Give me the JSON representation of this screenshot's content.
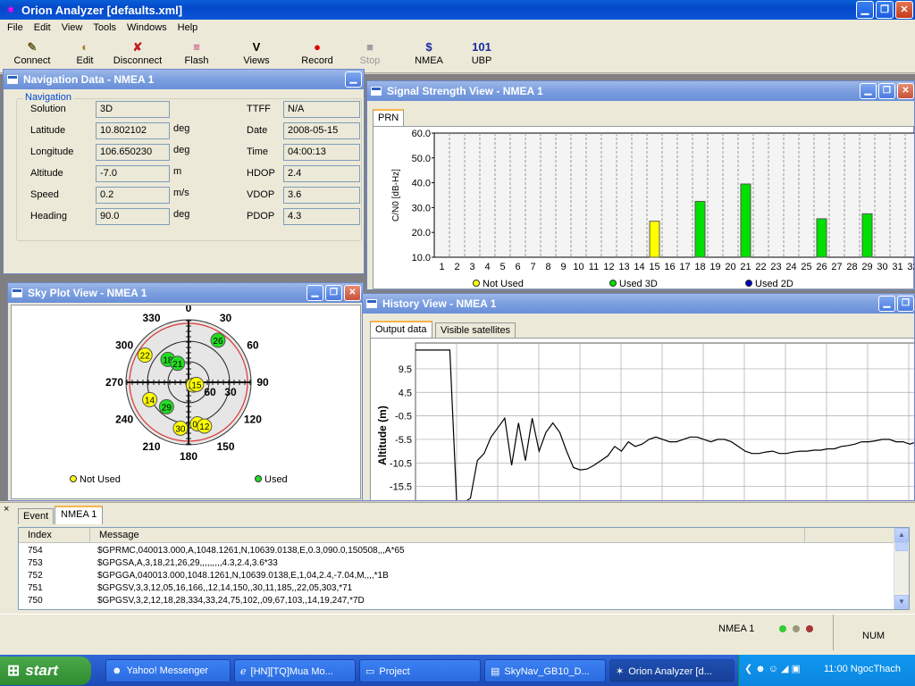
{
  "app": {
    "title": "Orion Analyzer [defaults.xml]"
  },
  "menu": [
    "File",
    "Edit",
    "View",
    "Tools",
    "Windows",
    "Help"
  ],
  "toolbar": [
    {
      "label": "Connect",
      "icon": "connect-icon",
      "glyph": "✎",
      "color": "#6b5b2b",
      "enabled": true
    },
    {
      "label": "Edit",
      "icon": "edit-icon",
      "glyph": "◐",
      "color": "#a08020",
      "enabled": true
    },
    {
      "label": "Disconnect",
      "icon": "disconnect-icon",
      "glyph": "✘",
      "color": "#c02020",
      "enabled": true
    },
    {
      "label": "Flash",
      "icon": "flash-icon",
      "glyph": "≡",
      "color": "#c03070",
      "enabled": true
    },
    {
      "label": "Views",
      "icon": "views-icon",
      "glyph": "V",
      "color": "#000000",
      "enabled": true
    },
    {
      "label": "Record",
      "icon": "record-icon",
      "glyph": "●",
      "color": "#e00000",
      "enabled": true
    },
    {
      "label": "Stop",
      "icon": "stop-icon",
      "glyph": "■",
      "color": "#a0a0a0",
      "enabled": false
    },
    {
      "label": "NMEA",
      "icon": "nmea-icon",
      "glyph": "$",
      "color": "#1a2aa0",
      "enabled": true
    },
    {
      "label": "UBP",
      "icon": "ubp-icon",
      "glyph": "101",
      "color": "#1a2aa0",
      "enabled": true
    }
  ],
  "nav": {
    "title": "Navigation Data - NMEA 1",
    "group": "Navigation",
    "left": [
      {
        "label": "Solution",
        "value": "3D",
        "unit": ""
      },
      {
        "label": "Latitude",
        "value": "10.802102",
        "unit": "deg"
      },
      {
        "label": "Longitude",
        "value": "106.650230",
        "unit": "deg"
      },
      {
        "label": "Altitude",
        "value": "-7.0",
        "unit": "m"
      },
      {
        "label": "Speed",
        "value": "0.2",
        "unit": "m/s"
      },
      {
        "label": "Heading",
        "value": "90.0",
        "unit": "deg"
      }
    ],
    "right": [
      {
        "label": "TTFF",
        "value": "N/A"
      },
      {
        "label": "Date",
        "value": "2008-05-15"
      },
      {
        "label": "Time",
        "value": "04:00:13"
      },
      {
        "label": "HDOP",
        "value": "2.4"
      },
      {
        "label": "VDOP",
        "value": "3.6"
      },
      {
        "label": "PDOP",
        "value": "4.3"
      }
    ]
  },
  "signal": {
    "title": "Signal Strength View - NMEA 1",
    "tab": "PRN",
    "legend": [
      {
        "label": "Not Used",
        "color": "#ffff00"
      },
      {
        "label": "Used 3D",
        "color": "#00e000"
      },
      {
        "label": "Used 2D",
        "color": "#0000c0"
      }
    ]
  },
  "sky": {
    "title": "Sky Plot View - NMEA 1",
    "azimuth_labels": [
      "0",
      "30",
      "60",
      "90",
      "120",
      "150",
      "180",
      "210",
      "240",
      "270",
      "300",
      "330"
    ],
    "elev_labels": [
      "60",
      "30"
    ],
    "legend_not_used": "Not Used",
    "legend_used": "Used",
    "sats": [
      {
        "prn": "18",
        "az": 318,
        "el": 45,
        "used": true
      },
      {
        "prn": "26",
        "az": 35,
        "el": 15,
        "used": true
      },
      {
        "prn": "22",
        "az": 302,
        "el": 15,
        "used": false
      },
      {
        "prn": "21",
        "az": 330,
        "el": 58,
        "used": true
      },
      {
        "prn": "24",
        "az": 120,
        "el": 82,
        "used": false
      },
      {
        "prn": "15",
        "az": 105,
        "el": 78,
        "used": false
      },
      {
        "prn": "14",
        "az": 246,
        "el": 28,
        "used": false
      },
      {
        "prn": "29",
        "az": 222,
        "el": 42,
        "used": true
      },
      {
        "prn": "30",
        "az": 190,
        "el": 22,
        "used": false
      },
      {
        "prn": "05",
        "az": 168,
        "el": 28,
        "used": false
      },
      {
        "prn": "12",
        "az": 160,
        "el": 22,
        "used": false
      }
    ]
  },
  "history": {
    "title": "History View - NMEA 1",
    "tabs": [
      "Output data",
      "Visible satellites"
    ],
    "ylabel": "Altitude (m)"
  },
  "log": {
    "tabs": [
      "Event",
      "NMEA 1"
    ],
    "columns": [
      "Index",
      "Message"
    ],
    "rows": [
      {
        "index": "754",
        "message": "$GPRMC,040013.000,A,1048.1261,N,10639.0138,E,0.3,090.0,150508,,,A*65"
      },
      {
        "index": "753",
        "message": "$GPGSA,A,3,18,21,26,29,,,,,,,,,4.3,2.4,3.6*33"
      },
      {
        "index": "752",
        "message": "$GPGGA,040013.000,1048.1261,N,10639.0138,E,1,04,2.4,-7.04,M,,,,*1B"
      },
      {
        "index": "751",
        "message": "$GPGSV,3,3,12,05,16,166,,12,14,150,,30,11,185,,22,05,303,*71"
      },
      {
        "index": "750",
        "message": "$GPGSV,3,2,12,18,28,334,33,24,75,102,,09,67,103,,14,19,247,*7D"
      }
    ]
  },
  "status": {
    "port": "NMEA 1",
    "num": "NUM"
  },
  "taskbar": {
    "start": "start",
    "tasks": [
      "Yahoo! Messenger",
      "[HN][TQ]Mua Mo...",
      "Project",
      "SkyNav_GB10_D...",
      "Orion Analyzer [d..."
    ],
    "clock": "11:00 NgocThach"
  },
  "chart_data": [
    {
      "type": "bar",
      "ylabel": "C/N0 [dB-Hz]",
      "ylim": [
        10,
        60
      ],
      "yticks": [
        "60.0",
        "50.0",
        "40.0",
        "30.0",
        "20.0",
        "10.0"
      ],
      "categories": [
        "1",
        "2",
        "3",
        "4",
        "5",
        "6",
        "7",
        "8",
        "9",
        "10",
        "11",
        "12",
        "13",
        "14",
        "15",
        "16",
        "17",
        "18",
        "19",
        "20",
        "21",
        "22",
        "23",
        "24",
        "25",
        "26",
        "27",
        "28",
        "29",
        "30",
        "31",
        "32"
      ],
      "bars": [
        {
          "prn": "15",
          "value": 24.5,
          "status": "Not Used"
        },
        {
          "prn": "18",
          "value": 32.5,
          "status": "Used 3D"
        },
        {
          "prn": "21",
          "value": 39.5,
          "status": "Used 3D"
        },
        {
          "prn": "26",
          "value": 25.5,
          "status": "Used 3D"
        },
        {
          "prn": "29",
          "value": 27.5,
          "status": "Used 3D"
        }
      ]
    },
    {
      "type": "line",
      "ylabel": "Altitude (m)",
      "yticks": [
        "9.5",
        "4.5",
        "-0.5",
        "-5.5",
        "-10.5",
        "-15.5"
      ],
      "ylim": [
        -19,
        15
      ],
      "series": [
        {
          "values": [
            13.5,
            13.5,
            13.5,
            13.5,
            13.5,
            13.5,
            -20,
            -20,
            -18,
            -10,
            -8.5,
            -5,
            -3,
            -1,
            -11,
            -2,
            -10,
            -1,
            -8,
            -4,
            -2,
            -4,
            -8,
            -11.5,
            -12,
            -11.8,
            -11,
            -10,
            -9,
            -7,
            -8,
            -6,
            -7,
            -6.5,
            -5.5,
            -5,
            -5.5,
            -6,
            -6,
            -5.5,
            -5,
            -5,
            -5.5,
            -6,
            -5.5,
            -5.5,
            -6,
            -7,
            -8,
            -8.5,
            -8.5,
            -8.2,
            -8,
            -8.5,
            -8.5,
            -8.2,
            -8,
            -8,
            -7.8,
            -7.8,
            -7.5,
            -7.5,
            -7,
            -6.8,
            -6.5,
            -6,
            -6,
            -5.8,
            -5.5,
            -5.5,
            -6,
            -6,
            -6.5,
            -6
          ]
        }
      ]
    }
  ]
}
